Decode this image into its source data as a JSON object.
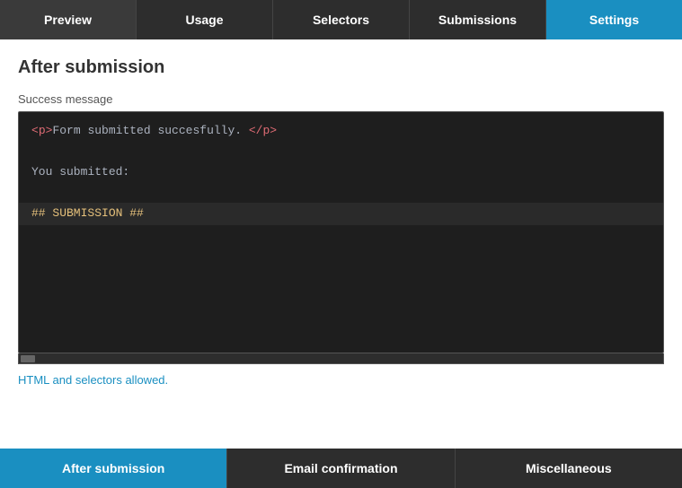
{
  "topNav": {
    "items": [
      {
        "label": "Preview",
        "active": false
      },
      {
        "label": "Usage",
        "active": false
      },
      {
        "label": "Selectors",
        "active": false
      },
      {
        "label": "Submissions",
        "active": false
      },
      {
        "label": "Settings",
        "active": true
      }
    ]
  },
  "main": {
    "title": "After submission",
    "fieldLabel": "Success message",
    "codeLines": [
      {
        "type": "tag",
        "content": "<p>Form submitted succesfully. </p>"
      },
      {
        "type": "blank"
      },
      {
        "type": "text",
        "content": "You submitted:"
      },
      {
        "type": "blank"
      },
      {
        "type": "submission",
        "content": "## SUBMISSION ##",
        "highlight": true
      }
    ],
    "hint": "HTML and selectors allowed."
  },
  "bottomNav": {
    "items": [
      {
        "label": "After submission",
        "active": true
      },
      {
        "label": "Email confirmation",
        "active": false
      },
      {
        "label": "Miscellaneous",
        "active": false
      }
    ]
  }
}
